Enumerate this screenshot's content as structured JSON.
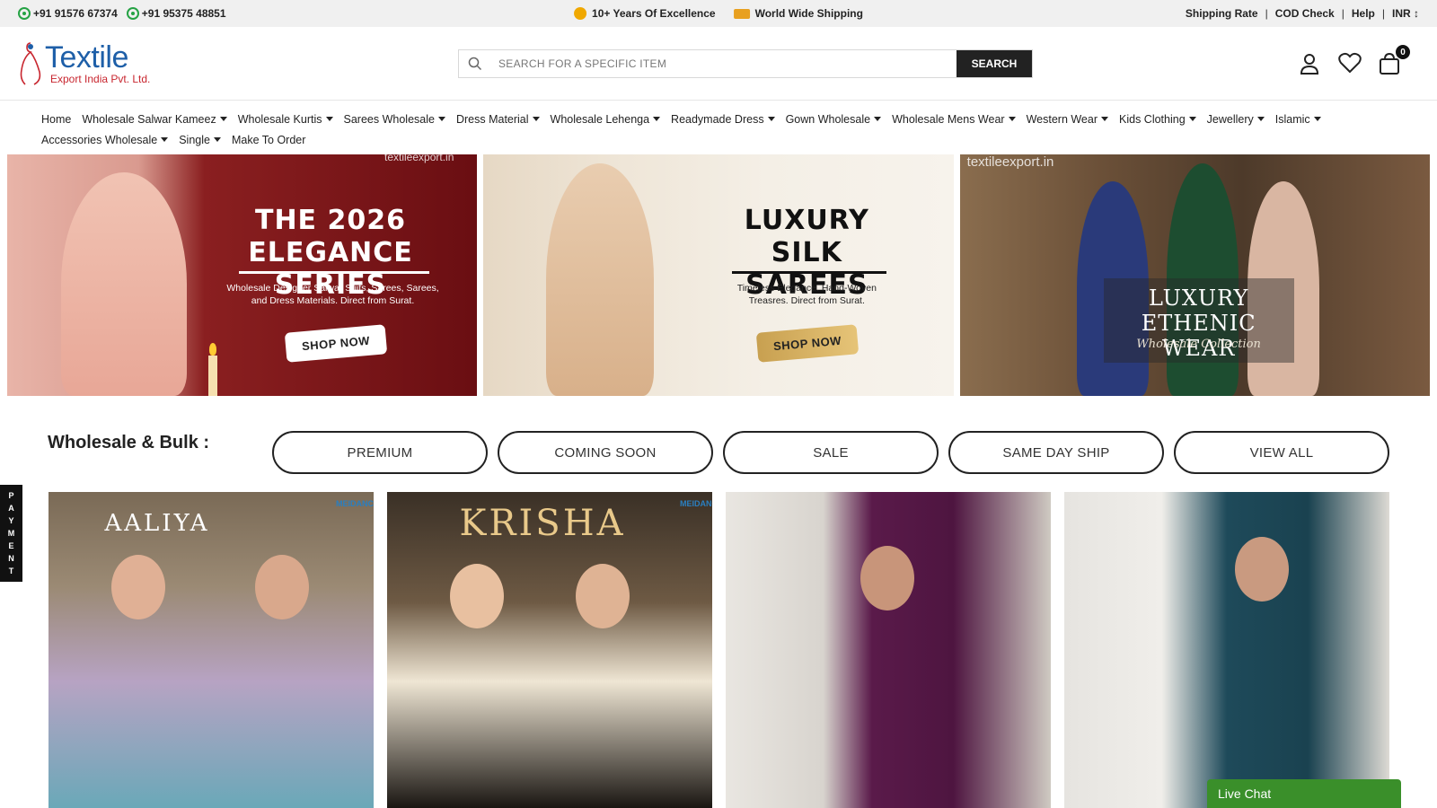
{
  "topbar": {
    "phone1": "+91 91576 67374",
    "phone2": "+91 95375 48851",
    "excellence": "10+ Years Of Excellence",
    "shipping": "World Wide Shipping",
    "links": [
      "Shipping Rate",
      "COD Check",
      "Help",
      "INR ↕"
    ]
  },
  "header": {
    "logo_name": "Textile",
    "logo_sub": "Export India Pvt. Ltd.",
    "search_placeholder": "SEARCH FOR A SPECIFIC ITEM",
    "search_button": "SEARCH",
    "cart_count": "0"
  },
  "nav": {
    "row1": [
      "Home",
      "Wholesale Salwar Kameez",
      "Wholesale Kurtis",
      "Sarees Wholesale",
      "Dress Material",
      "Wholesale Lehenga",
      "Readymade Dress",
      "Gown Wholesale",
      "Wholesale Mens Wear",
      "Western Wear",
      "Kids Clothing",
      "Jewellery",
      "Islamic"
    ],
    "row2": [
      "Accessories Wholesale",
      "Single",
      "Make To Order"
    ]
  },
  "banners": {
    "b1": {
      "watermark": "textileexport.in",
      "title_line1": "THE 2026",
      "title_line2": "ELEGANCE SERIES",
      "subtitle": "Wholesale Designer Salwar Suits, Sarees, Sarees, and Dress Materials. Direct from Surat.",
      "button": "SHOP NOW"
    },
    "b2": {
      "title_line1": "LUXURY",
      "title_line2": "SILK SAREES",
      "subtitle": "Timeless Elegance. Hand-Woven Treasres. Direct from Surat.",
      "button": "SHOP NOW"
    },
    "b3": {
      "watermark": "textileexport.in",
      "title_line1": "LUXURY",
      "title_line2": "ETHENIC WEAR",
      "subtitle": "Wholesale Collection"
    }
  },
  "wholesale": {
    "title": "Wholesale & Bulk :",
    "filters": [
      "PREMIUM",
      "COMING SOON",
      "SALE",
      "SAME DAY SHIP",
      "VIEW ALL"
    ]
  },
  "payment_tab": [
    "P",
    "A",
    "Y",
    "M",
    "E",
    "N",
    "T"
  ],
  "products": [
    {
      "title": "AALIYA",
      "brand": "MEIDANCY"
    },
    {
      "title": "KRISHA",
      "brand": "MEIDANC"
    },
    {
      "title": ""
    },
    {
      "title": ""
    }
  ],
  "livechat": "Live Chat"
}
